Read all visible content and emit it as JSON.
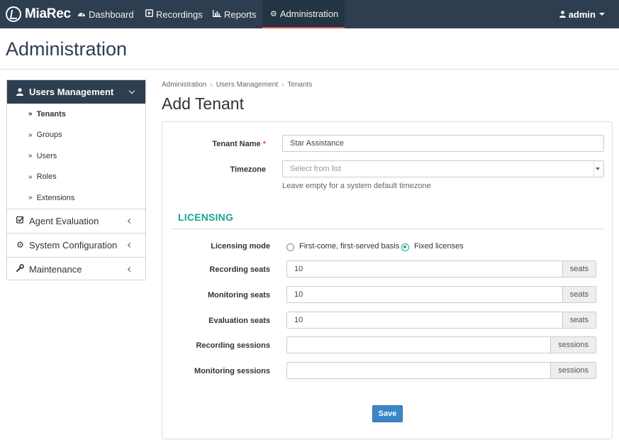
{
  "brand": {
    "name": "MiaRec"
  },
  "nav": {
    "items": [
      {
        "label": "Dashboard"
      },
      {
        "label": "Recordings"
      },
      {
        "label": "Reports"
      },
      {
        "label": "Administration"
      }
    ],
    "user": "admin"
  },
  "page": {
    "title": "Administration"
  },
  "sidebar": {
    "active_section": "Users Management",
    "sub_items": [
      {
        "label": "Tenants"
      },
      {
        "label": "Groups"
      },
      {
        "label": "Users"
      },
      {
        "label": "Roles"
      },
      {
        "label": "Extensions"
      }
    ],
    "sections": [
      {
        "label": "Agent Evaluation"
      },
      {
        "label": "System Configuration"
      },
      {
        "label": "Maintenance"
      }
    ]
  },
  "breadcrumb": [
    "Administration",
    "Users Management",
    "Tenants"
  ],
  "form": {
    "title": "Add Tenant",
    "tenant_name_label": "Tenant Name",
    "required_mark": "*",
    "tenant_name_value": "Star Assistance",
    "timezone_label": "Timezone",
    "timezone_placeholder": "Select from list",
    "timezone_help": "Leave empty for a system default timezone",
    "licensing_header": "LICENSING",
    "licensing_mode_label": "Licensing mode",
    "licensing_options": [
      {
        "label": "First-come, first-served basis",
        "selected": false
      },
      {
        "label": "Fixed licenses",
        "selected": true
      }
    ],
    "fields": [
      {
        "label": "Recording seats",
        "value": "10",
        "unit": "seats"
      },
      {
        "label": "Monitoring seats",
        "value": "10",
        "unit": "seats"
      },
      {
        "label": "Evaluation seats",
        "value": "10",
        "unit": "seats"
      },
      {
        "label": "Recording sessions",
        "value": "",
        "unit": "sessions"
      },
      {
        "label": "Monitoring sessions",
        "value": "",
        "unit": "sessions"
      }
    ],
    "save_label": "Save"
  },
  "colors": {
    "nav_bg": "#2d3e50",
    "accent": "#1aa394",
    "primary_button": "#3a86c8",
    "active_tab_underline": "#d9534f"
  }
}
